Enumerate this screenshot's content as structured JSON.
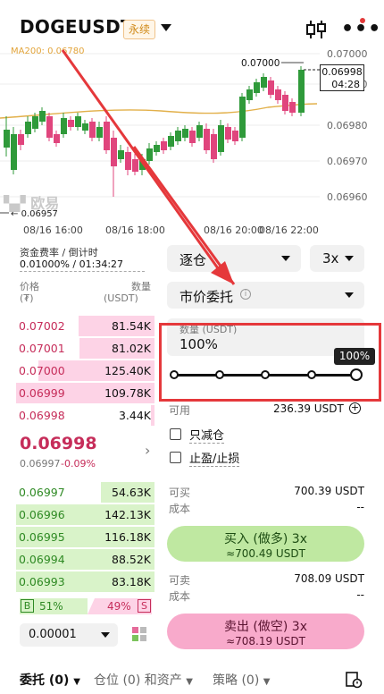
{
  "header": {
    "symbol": "DOGEUSDT",
    "badge": "永续",
    "more": "•••"
  },
  "chart": {
    "ma_label": "MA200: 0.06780",
    "price_axis": [
      "0.07000",
      "0.06990",
      "0.06980",
      "0.06970",
      "0.06960"
    ],
    "time_axis": [
      "08/16 16:00",
      "08/16 18:00",
      "08/16 20:00",
      "08/16 22:00"
    ],
    "high_label": "0.07000",
    "low_label": "0.06957",
    "last_price": "0.06998",
    "countdown": "04:28",
    "watermark": "欧易"
  },
  "funding": {
    "label": "资金费率 / 倒计时",
    "value": "0.01000% / 01:34:27"
  },
  "orderbook": {
    "col_price": "价格",
    "col_price_unit": "(₮)",
    "col_qty": "数量",
    "col_qty_unit": "(USDT)",
    "asks": [
      {
        "price": "0.07002",
        "qty": "81.54K"
      },
      {
        "price": "0.07001",
        "qty": "81.02K"
      },
      {
        "price": "0.07000",
        "qty": "125.40K"
      },
      {
        "price": "0.06999",
        "qty": "109.78K"
      },
      {
        "price": "0.06998",
        "qty": "3.44K"
      }
    ],
    "mid_price": "0.06998",
    "mid_sub": "0.06997",
    "mid_change": "-0.09%",
    "bids": [
      {
        "price": "0.06997",
        "qty": "54.63K"
      },
      {
        "price": "0.06996",
        "qty": "142.13K"
      },
      {
        "price": "0.06995",
        "qty": "116.18K"
      },
      {
        "price": "0.06994",
        "qty": "88.52K"
      },
      {
        "price": "0.06993",
        "qty": "83.18K"
      }
    ],
    "buy_letter": "B",
    "buy_pct": "51%",
    "sell_pct": "49%",
    "sell_letter": "S",
    "depth_select": "0.00001"
  },
  "order_form": {
    "margin_mode": "逐仓",
    "leverage": "3x",
    "order_type": "市价委托",
    "amount_label": "数量 (USDT)",
    "amount_value": "100%",
    "slider_tip": "100%",
    "available_label": "可用",
    "available_value": "236.39 USDT",
    "reduce_only": "只减仓",
    "tp_sl": "止盈/止损",
    "can_buy_label": "可买",
    "can_buy_value": "700.39 USDT",
    "cost_label": "成本",
    "cost_value": "--",
    "buy_button": "买入 (做多) 3x",
    "buy_sub": "≈700.49 USDT",
    "can_sell_label": "可卖",
    "can_sell_value": "708.09 USDT",
    "cost2_label": "成本",
    "cost2_value": "--",
    "sell_button": "卖出 (做空) 3x",
    "sell_sub": "≈708.19 USDT"
  },
  "bottom_tabs": {
    "orders": "委托 (0)",
    "positions": "仓位 (0) 和资产",
    "strategy": "策略 (0)"
  },
  "colors": {
    "ask": "#c62d5a",
    "bid": "#2f8a24",
    "annotation": "#e5383b"
  }
}
